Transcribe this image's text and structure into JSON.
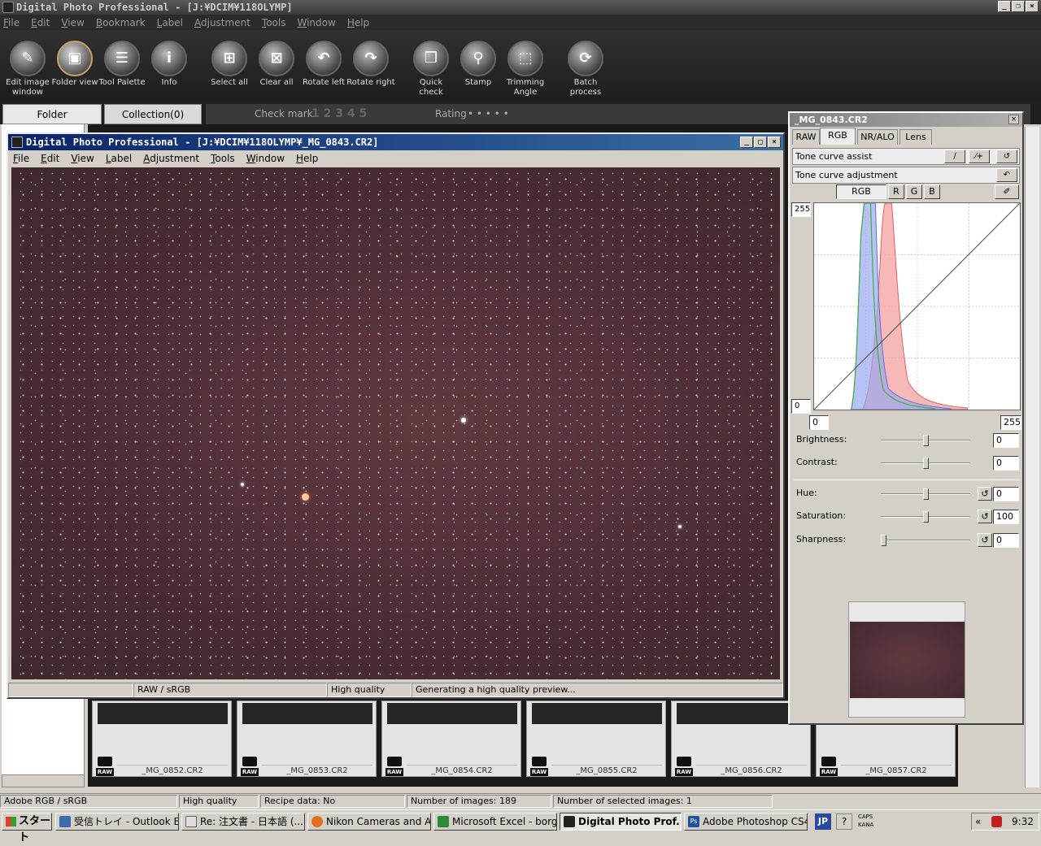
{
  "app": {
    "title": "Digital Photo Professional - [J:¥DCIM¥118OLYMP]",
    "menu": [
      "File",
      "Edit",
      "View",
      "Bookmark",
      "Label",
      "Adjustment",
      "Tools",
      "Window",
      "Help"
    ]
  },
  "toolbar": [
    {
      "label": "Edit image window",
      "icon": "edit-image-icon",
      "glyph": "✎"
    },
    {
      "label": "Folder view",
      "icon": "folder-view-icon",
      "glyph": "▣",
      "active": true
    },
    {
      "label": "Tool Palette",
      "icon": "tool-palette-icon",
      "glyph": "☰"
    },
    {
      "label": "Info",
      "icon": "info-icon",
      "glyph": "i"
    },
    {
      "label": "Select all",
      "icon": "select-all-icon",
      "glyph": "⊞"
    },
    {
      "label": "Clear all",
      "icon": "clear-all-icon",
      "glyph": "⊠"
    },
    {
      "label": "Rotate left",
      "icon": "rotate-left-icon",
      "glyph": "↶"
    },
    {
      "label": "Rotate right",
      "icon": "rotate-right-icon",
      "glyph": "↷"
    },
    {
      "label": "Quick check",
      "icon": "quick-check-icon",
      "glyph": "❐"
    },
    {
      "label": "Stamp",
      "icon": "stamp-icon",
      "glyph": "⚲"
    },
    {
      "label": "Trimming Angle",
      "icon": "trimming-angle-icon",
      "glyph": "⬚"
    },
    {
      "label": "Batch process",
      "icon": "batch-process-icon",
      "glyph": "⟳"
    }
  ],
  "tabs": {
    "folder": "Folder",
    "collection": "Collection(0)",
    "checkmark": "Check mark",
    "checkmark_nums": "1 2 3 4 5",
    "rating": "Rating",
    "rating_dots": "• • • • •"
  },
  "image_window": {
    "title": "Digital Photo Professional - [J:¥DCIM¥118OLYMP¥_MG_0843.CR2]",
    "menu": [
      "File",
      "Edit",
      "View",
      "Label",
      "Adjustment",
      "Tools",
      "Window",
      "Help"
    ],
    "status": {
      "color": "RAW / sRGB",
      "quality": "High quality",
      "message": "Generating a high quality preview..."
    }
  },
  "thumbnails": [
    {
      "name": "_MG_0852.CR2",
      "badge": "RAW"
    },
    {
      "name": "_MG_0853.CR2",
      "badge": "RAW"
    },
    {
      "name": "_MG_0854.CR2",
      "badge": "RAW"
    },
    {
      "name": "_MG_0855.CR2",
      "badge": "RAW"
    },
    {
      "name": "_MG_0856.CR2",
      "badge": "RAW"
    },
    {
      "name": "_MG_0857.CR2",
      "badge": "RAW"
    }
  ],
  "palette": {
    "title": "_MG_0843.CR2",
    "tabs": [
      "RAW",
      "RGB",
      "NR/ALO",
      "Lens"
    ],
    "active_tab": "RGB",
    "tone_curve_assist": "Tone curve assist",
    "tone_curve_adjustment": "Tone curve adjustment",
    "channels": [
      "RGB",
      "R",
      "G",
      "B"
    ],
    "curve_ymax": "255",
    "curve_ymin": "0",
    "input_low": "0",
    "input_high": "255",
    "sliders": [
      {
        "label": "Brightness:",
        "value": "0",
        "pos": 0.5
      },
      {
        "label": "Contrast:",
        "value": "0",
        "pos": 0.5
      },
      {
        "label": "Hue:",
        "value": "0",
        "pos": 0.5
      },
      {
        "label": "Saturation:",
        "value": "100",
        "pos": 0.5
      },
      {
        "label": "Sharpness:",
        "value": "0",
        "pos": 0.0
      }
    ]
  },
  "statusbar": {
    "colorspace": "Adobe RGB / sRGB",
    "quality": "High quality",
    "recipe": "Recipe data: No",
    "images": "Number of images: 189",
    "selected": "Number of selected images: 1"
  },
  "taskbar": {
    "start": "スタート",
    "buttons": [
      "受信トレイ - Outlook E...",
      "Re: 注文書 - 日本語 (...",
      "Nikon Cameras and A...",
      "Microsoft Excel - borg...",
      "Digital Photo Prof...",
      "Adobe Photoshop CS4 ..."
    ],
    "lang": "JP",
    "caps": "CAPS",
    "kana": "KANA",
    "time": "9:32"
  },
  "colors": {
    "accent": "#0a246a",
    "histogram_red": "#f08080",
    "histogram_blue": "#8090e0",
    "histogram_green": "#40b040"
  }
}
